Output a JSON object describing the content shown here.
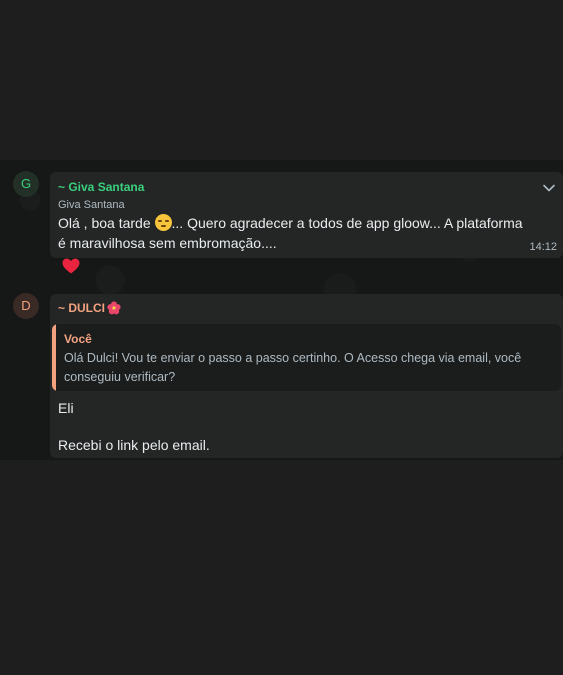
{
  "messages": [
    {
      "avatar_initial": "G",
      "sender": "~ Giva Santana",
      "pushname": "Giva Santana",
      "text_before_emoji": "Olá , boa tarde ",
      "emoji": "relieved-face",
      "text_after_emoji": "... Quero agradecer a todos de app gloow... A plataforma é maravilhosa sem embromação....",
      "time": "14:12",
      "reaction": "red-heart",
      "accent_color": "#3ad07c"
    },
    {
      "avatar_initial": "D",
      "sender": "~ DULCI",
      "sender_emoji": "hibiscus",
      "quoted": {
        "author": "Você",
        "text": "Olá Dulci! Vou te enviar o passo a passo certinho. O Acesso chega via email, você conseguiu verificar?"
      },
      "lines": [
        "Eli",
        "Recebi o link pelo email."
      ],
      "accent_color": "#f3a280"
    }
  ]
}
